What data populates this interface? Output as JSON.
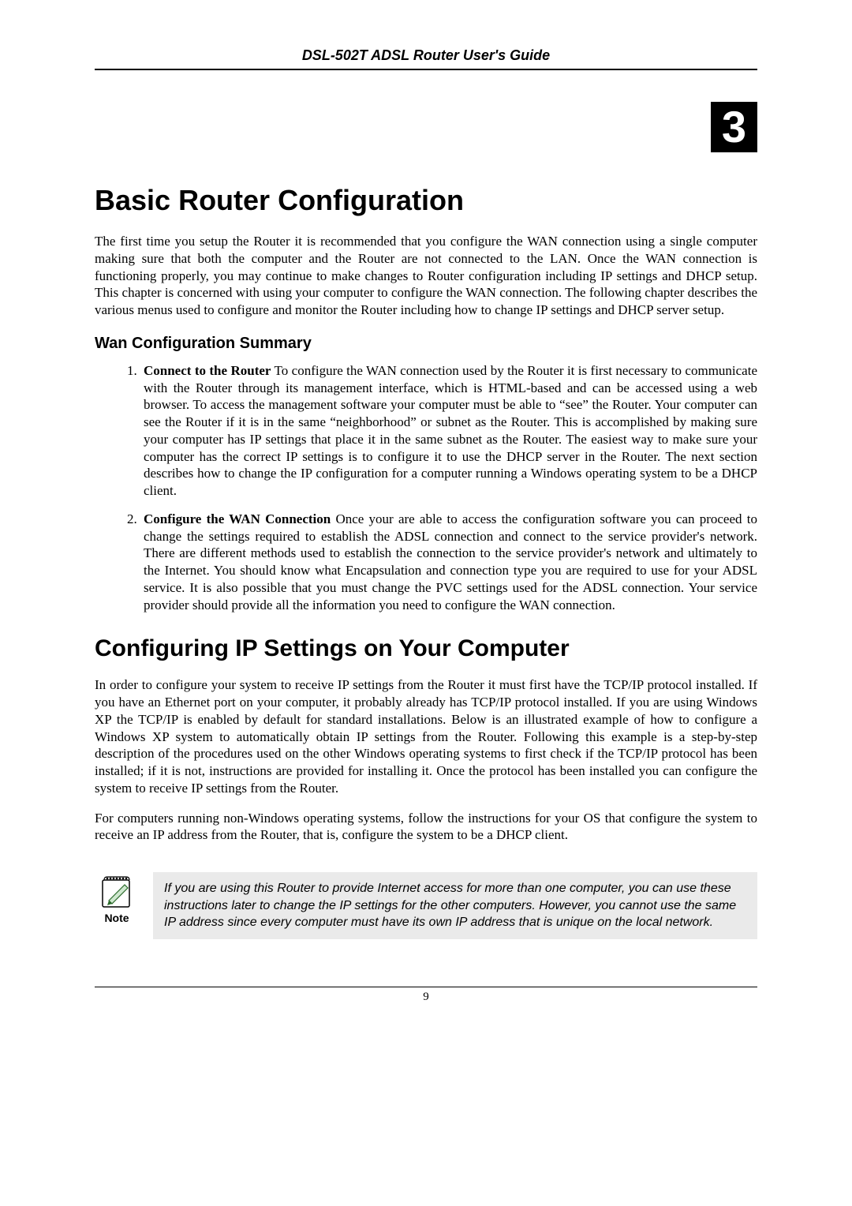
{
  "header": {
    "title": "DSL-502T ADSL Router User's Guide"
  },
  "chapter": {
    "number": "3",
    "title": "Basic Router Configuration",
    "intro": "The first time you setup the Router it is recommended that you configure the WAN connection using a single computer making sure that both the computer and the Router are not connected to the LAN. Once the WAN connection is functioning properly, you may continue to make changes to Router configuration including IP settings and DHCP setup. This chapter is concerned with using your computer to configure the WAN connection. The following chapter describes the various menus used to configure and monitor the Router including how to change IP settings and DHCP server setup."
  },
  "wan_summary": {
    "heading": "Wan Configuration Summary",
    "items": [
      {
        "bold": "Connect to the Router",
        "text": " To configure the WAN connection used by the Router it is first necessary to communicate with the Router through its management interface, which is HTML-based and can be accessed using a web browser. To access the management software your computer must be able to “see” the Router. Your computer can see the Router if it is in the same “neighborhood” or subnet as the Router. This is accomplished by making sure your computer has IP settings that place it in the same subnet as the Router. The easiest way to make sure your computer has the correct IP settings is to configure it to use the DHCP server in the Router. The next section describes how to change the IP configuration for a computer running a Windows operating system to be a DHCP client."
      },
      {
        "bold": "Configure the WAN Connection",
        "text": " Once your are able to access the configuration software you can proceed to change the settings required to establish the ADSL connection and connect to the service provider's network. There are different methods used to establish the connection to the service provider's network and ultimately to the Internet. You should know what Encapsulation and connection type you are required to use for your ADSL service. It is also possible that you must change the PVC settings used for the ADSL connection. Your service provider should provide all the information you need to configure the WAN connection."
      }
    ]
  },
  "ip_section": {
    "heading": "Configuring IP Settings on Your Computer",
    "p1": "In order to configure your system to receive IP settings from the Router it must first have the TCP/IP protocol installed. If you have an Ethernet port on your computer, it probably already has TCP/IP protocol installed. If you are using Windows XP the TCP/IP is enabled by default for standard installations. Below is an illustrated example of how to configure a Windows XP system to automatically obtain IP settings from the Router. Following this example is a step-by-step description of the procedures used on the other Windows operating systems to first check if the TCP/IP protocol has been installed; if it is not, instructions are provided for installing it. Once the protocol has been installed you can configure the system to receive IP settings from the Router.",
    "p2": "For computers running non-Windows operating systems, follow the instructions for your OS that configure the system to receive an IP address from the Router, that is, configure the system to be a DHCP client."
  },
  "note": {
    "label": "Note",
    "text": "If you are using this Router to provide Internet access for more than one computer, you can use these instructions later to change the IP settings for the other computers. However, you cannot use the same IP address since every computer must have its own IP address that is unique on the local network."
  },
  "footer": {
    "page_number": "9"
  }
}
